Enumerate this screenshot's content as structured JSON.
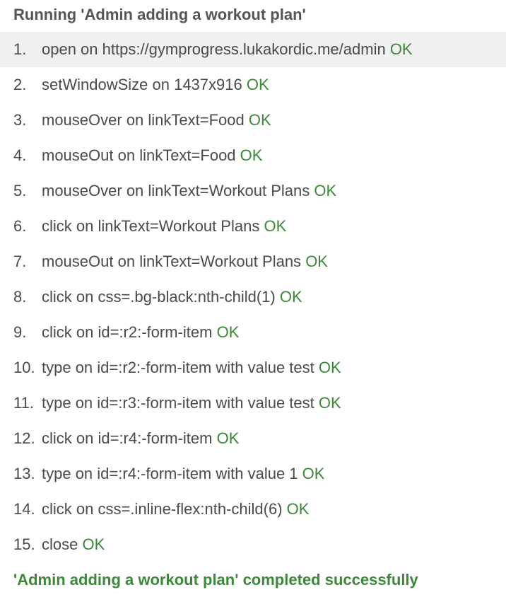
{
  "header": {
    "title": "Running 'Admin adding a workout plan'"
  },
  "steps": [
    {
      "num": "1.",
      "command": "open on https://gymprogress.lukakordic.me/admin",
      "status": "OK"
    },
    {
      "num": "2.",
      "command": "setWindowSize on 1437x916",
      "status": "OK"
    },
    {
      "num": "3.",
      "command": "mouseOver on linkText=Food",
      "status": "OK"
    },
    {
      "num": "4.",
      "command": "mouseOut on linkText=Food",
      "status": "OK"
    },
    {
      "num": "5.",
      "command": "mouseOver on linkText=Workout Plans",
      "status": "OK"
    },
    {
      "num": "6.",
      "command": "click on linkText=Workout Plans",
      "status": "OK"
    },
    {
      "num": "7.",
      "command": "mouseOut on linkText=Workout Plans",
      "status": "OK"
    },
    {
      "num": "8.",
      "command": "click on css=.bg-black:nth-child(1)",
      "status": "OK"
    },
    {
      "num": "9.",
      "command": "click on id=:r2:-form-item",
      "status": "OK"
    },
    {
      "num": "10.",
      "command": "type on id=:r2:-form-item with value test",
      "status": "OK"
    },
    {
      "num": "11.",
      "command": "type on id=:r3:-form-item with value test",
      "status": "OK"
    },
    {
      "num": "12.",
      "command": "click on id=:r4:-form-item",
      "status": "OK"
    },
    {
      "num": "13.",
      "command": "type on id=:r4:-form-item with value 1",
      "status": "OK"
    },
    {
      "num": "14.",
      "command": "click on css=.inline-flex:nth-child(6)",
      "status": "OK"
    },
    {
      "num": "15.",
      "command": "close",
      "status": "OK"
    }
  ],
  "footer": {
    "message": "'Admin adding a workout plan' completed successfully"
  },
  "colors": {
    "ok_green": "#3c873a",
    "highlight_row": "#f0f0f0",
    "header_gray": "#555555"
  }
}
